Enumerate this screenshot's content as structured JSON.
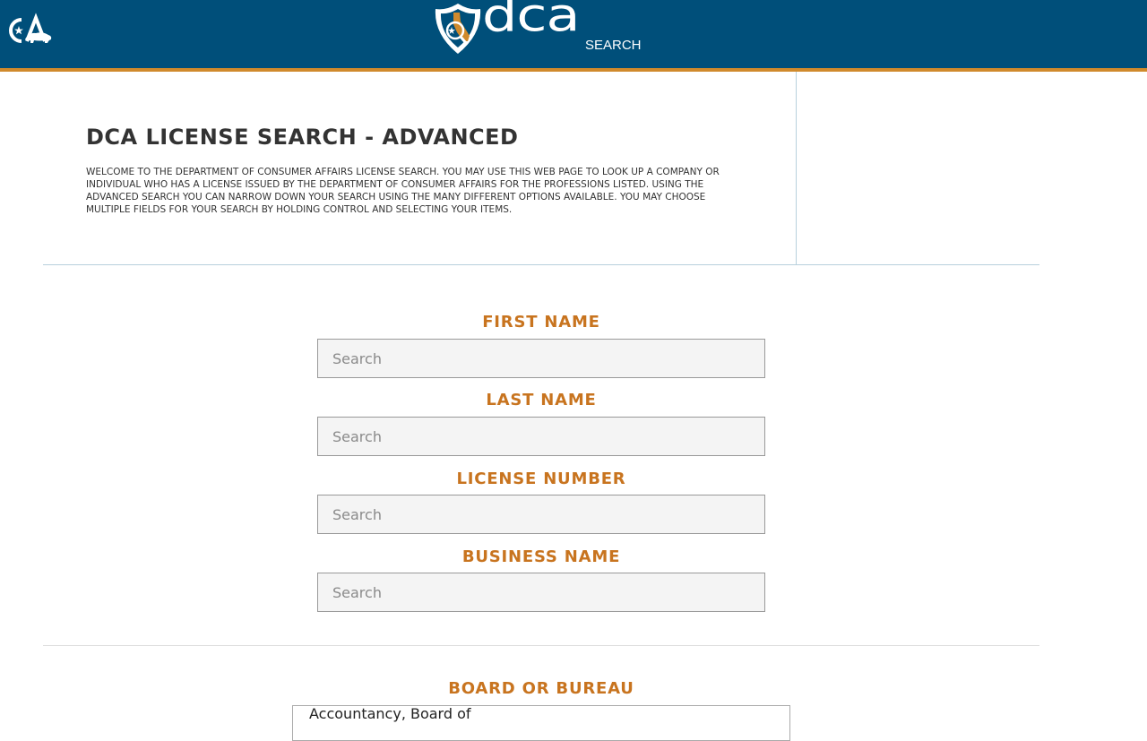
{
  "header": {
    "state_logo_text": "CA",
    "logo_wordmark": "dca",
    "logo_subtitle": "SEARCH"
  },
  "intro": {
    "title": "DCA LICENSE SEARCH - ADVANCED",
    "description": "WELCOME TO THE DEPARTMENT OF CONSUMER AFFAIRS LICENSE SEARCH. YOU MAY USE THIS WEB PAGE TO LOOK UP A COMPANY OR INDIVIDUAL WHO HAS A LICENSE ISSUED BY THE DEPARTMENT OF CONSUMER AFFAIRS FOR THE PROFESSIONS LISTED. USING THE ADVANCED SEARCH YOU CAN NARROW DOWN YOUR SEARCH USING THE MANY DIFFERENT OPTIONS AVAILABLE. YOU MAY CHOOSE MULTIPLE FIELDS FOR YOUR SEARCH BY HOLDING CONTROL AND SELECTING YOUR ITEMS."
  },
  "form": {
    "first_name": {
      "label": "FIRST NAME",
      "placeholder": "Search",
      "value": ""
    },
    "last_name": {
      "label": "LAST NAME",
      "placeholder": "Search",
      "value": ""
    },
    "license_number": {
      "label": "LICENSE NUMBER",
      "placeholder": "Search",
      "value": ""
    },
    "business_name": {
      "label": "BUSINESS NAME",
      "placeholder": "Search",
      "value": ""
    },
    "board": {
      "label": "BOARD OR BUREAU",
      "options": [
        "Accountancy, Board of"
      ]
    }
  },
  "colors": {
    "header_bg": "#004f7a",
    "accent_orange": "#d08a2c",
    "label_orange": "#c8741f",
    "title_text": "#333333"
  },
  "icons": {
    "state_logo": "ca-bear-icon",
    "dca_shield": "dca-shield-icon"
  }
}
